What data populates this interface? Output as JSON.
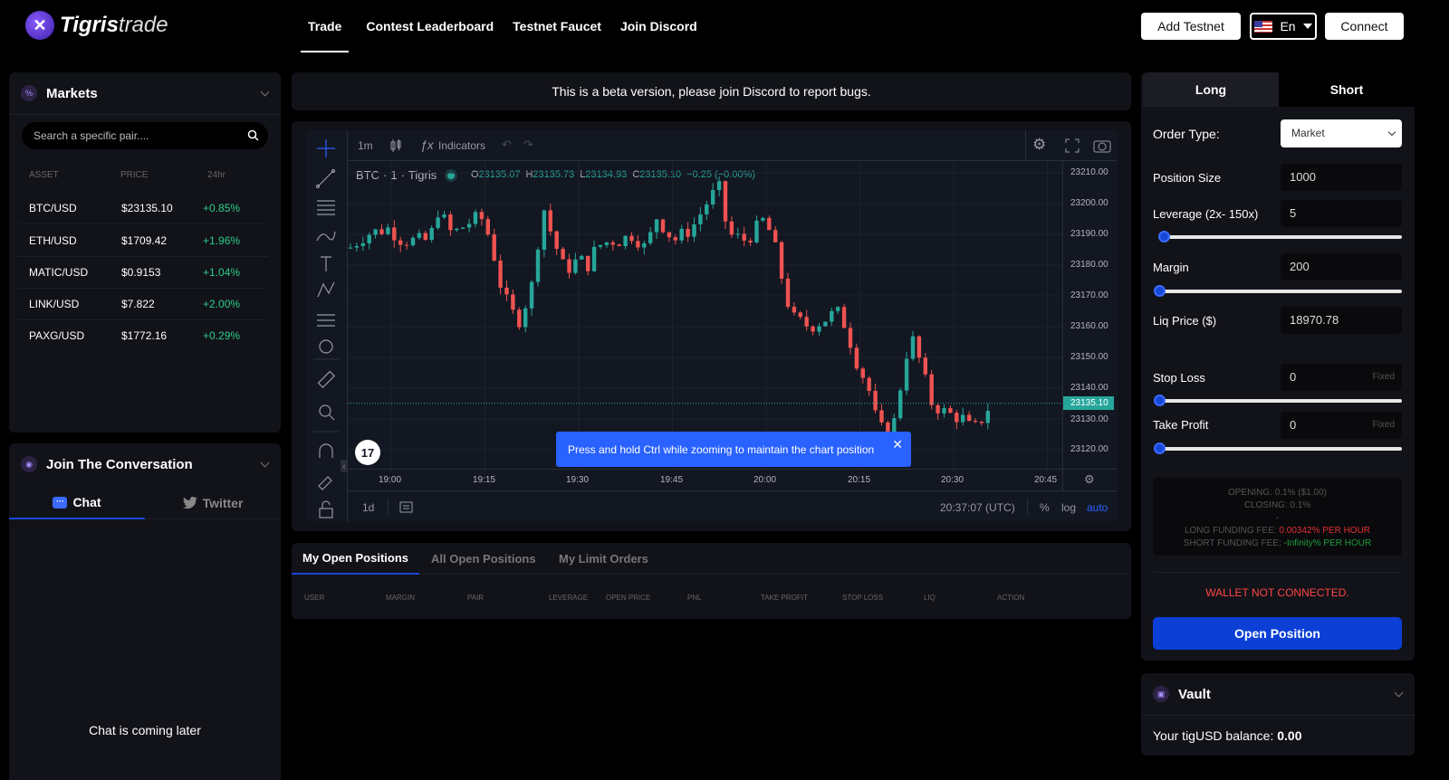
{
  "header": {
    "logo_bold": "Tigris",
    "logo_light": "trade",
    "nav": [
      "Trade",
      "Contest Leaderboard",
      "Testnet Faucet",
      "Join Discord"
    ],
    "add_testnet": "Add Testnet",
    "lang": "En",
    "connect": "Connect"
  },
  "markets": {
    "title": "Markets",
    "search_placeholder": "Search a specific pair....",
    "columns": [
      "ASSET",
      "PRICE",
      "24hr"
    ],
    "rows": [
      {
        "asset": "BTC/USD",
        "price": "$23135.10",
        "change": "+0.85%"
      },
      {
        "asset": "ETH/USD",
        "price": "$1709.42",
        "change": "+1.96%"
      },
      {
        "asset": "MATIC/USD",
        "price": "$0.9153",
        "change": "+1.04%"
      },
      {
        "asset": "LINK/USD",
        "price": "$7.822",
        "change": "+2.00%"
      },
      {
        "asset": "PAXG/USD",
        "price": "$1772.16",
        "change": "+0.29%"
      }
    ]
  },
  "conversation": {
    "title": "Join The Conversation",
    "tab_chat": "Chat",
    "tab_twitter": "Twitter",
    "empty": "Chat is coming later"
  },
  "beta_notice": "This is a beta version, please join Discord to report bugs.",
  "chart": {
    "interval": "1m",
    "indicators": "Indicators",
    "symbol": "BTC",
    "res": "1",
    "source": "Tigris",
    "ohlc": {
      "o": "23135.07",
      "h": "23135.73",
      "l": "23134.93",
      "c": "23135.10",
      "chg": "−0.25 (−0.00%)"
    },
    "price_ticks": [
      "23210.00",
      "23200.00",
      "23190.00",
      "23180.00",
      "23170.00",
      "23160.00",
      "23150.00",
      "23140.00",
      "23130.00",
      "23120.00"
    ],
    "last_price": "23135.10",
    "time_ticks": [
      "19:00",
      "19:15",
      "19:30",
      "19:45",
      "20:00",
      "20:15",
      "20:30",
      "20:45"
    ],
    "range": "1d",
    "clock": "20:37:07 (UTC)",
    "pct": "%",
    "log": "log",
    "auto": "auto",
    "tooltip": "Press and hold Ctrl while zooming to maintain the chart position",
    "tv_logo": "17"
  },
  "positions": {
    "tabs": [
      "My Open Positions",
      "All Open Positions",
      "My Limit Orders"
    ],
    "columns": [
      "USER",
      "MARGIN",
      "PAIR",
      "LEVERAGE",
      "OPEN PRICE",
      "PNL",
      "TAKE PROFIT",
      "STOP LOSS",
      "LIQ",
      "ACTION"
    ]
  },
  "order": {
    "tab_long": "Long",
    "tab_short": "Short",
    "order_type_label": "Order Type:",
    "order_type_value": "Market",
    "position_size_label": "Position Size",
    "position_size_value": "1000",
    "leverage_label": "Leverage (2x- 150x)",
    "leverage_value": "5",
    "margin_label": "Margin",
    "margin_value": "200",
    "liq_label": "Liq Price ($)",
    "liq_value": "18970.78",
    "stop_loss_label": "Stop Loss",
    "stop_loss_value": "0",
    "take_profit_label": "Take Profit",
    "take_profit_value": "0",
    "fixed": "Fixed",
    "opening_fee": "OPENING: 0.1% ($1.00)",
    "closing_fee": "CLOSING: 0.1%",
    "dash": "-",
    "long_funding_label": "LONG FUNDING FEE: ",
    "long_funding_value": "0.00342% PER HOUR",
    "short_funding_label": "SHORT FUNDING FEE: ",
    "short_funding_value": "-Infinity% PER HOUR",
    "wallet_status": "WALLET NOT CONNECTED.",
    "open_position": "Open Position"
  },
  "vault": {
    "title": "Vault",
    "balance_label": "Your tigUSD balance: ",
    "balance_value": "0.00"
  },
  "colors": {
    "accent": "#0b3fd6",
    "up": "#26a69a",
    "down": "#ef5350",
    "error": "#ff4545"
  }
}
